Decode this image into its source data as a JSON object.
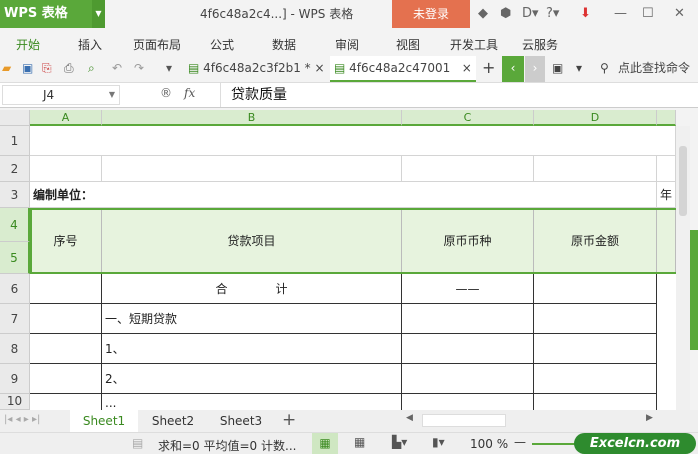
{
  "app": {
    "name": "WPS 表格",
    "window_title": "4f6c48a2c4...] - WPS 表格",
    "login": "未登录"
  },
  "menu": [
    "开始",
    "插入",
    "页面布局",
    "公式",
    "数据",
    "审阅",
    "视图",
    "开发工具",
    "云服务"
  ],
  "doc_tabs": [
    {
      "label": "4f6c48a2c3f2b1 *"
    },
    {
      "label": "4f6c48a2c47001"
    }
  ],
  "search_cmd": "点此查找命令",
  "formula": {
    "cell_ref": "J4",
    "fx": "fx",
    "value": "贷款质量"
  },
  "columns": [
    "A",
    "B",
    "C",
    "D"
  ],
  "rows": [
    "1",
    "2",
    "3",
    "4",
    "5",
    "6",
    "7",
    "8",
    "9",
    "10"
  ],
  "cells": {
    "r3a": "编制单位：",
    "r3e": "年",
    "h_a": "序号",
    "h_b": "贷款项目",
    "h_c": "原币币种",
    "h_d": "原币金额",
    "r6b": "合　　　　计",
    "r6c": "——",
    "r7b": "一、短期贷款",
    "r8b": "1、",
    "r9b": "2、",
    "r10b": "..."
  },
  "sheets": [
    "Sheet1",
    "Sheet2",
    "Sheet3"
  ],
  "status": {
    "summary": "求和=0  平均值=0  计数...",
    "zoom": "100 %",
    "watermark": "Excelcn.com"
  }
}
